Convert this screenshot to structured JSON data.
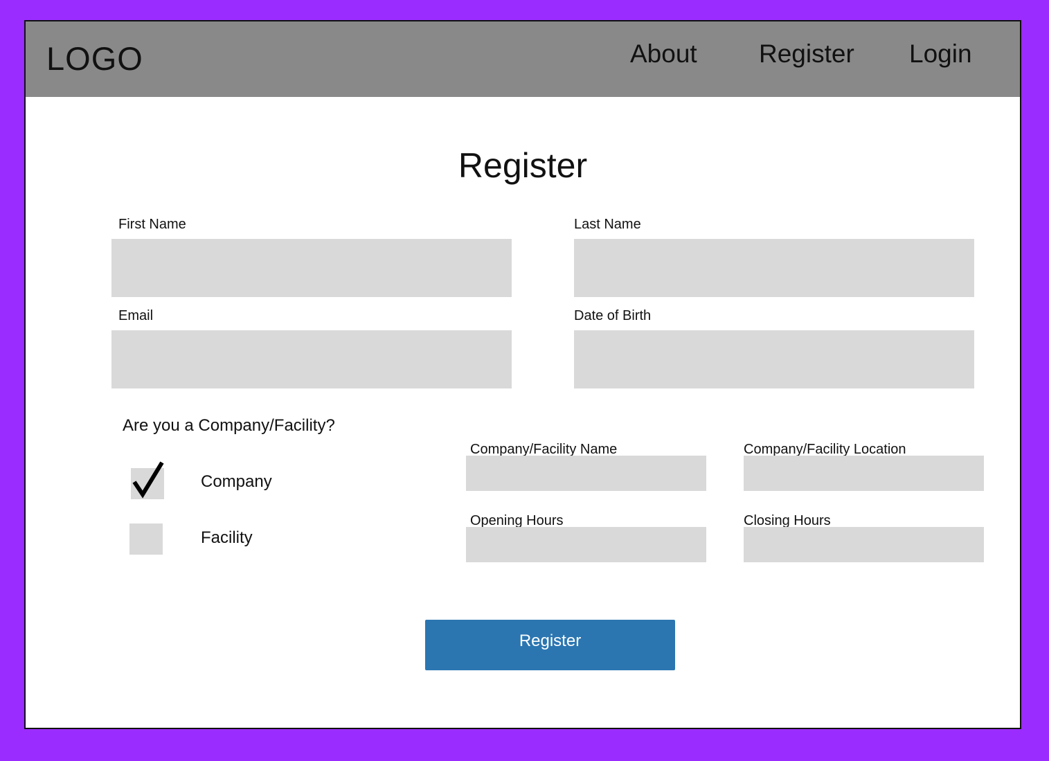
{
  "header": {
    "logo": "LOGO",
    "nav": {
      "about": "About",
      "register": "Register",
      "login": "Login"
    }
  },
  "form": {
    "title": "Register",
    "first_name": {
      "label": "First Name",
      "value": ""
    },
    "last_name": {
      "label": "Last Name",
      "value": ""
    },
    "email": {
      "label": "Email",
      "value": ""
    },
    "date_of_birth": {
      "label": "Date of Birth",
      "value": ""
    },
    "entity_question": "Are you a Company/Facility?",
    "options": {
      "company": {
        "label": "Company",
        "checked": true
      },
      "facility": {
        "label": "Facility",
        "checked": false
      }
    },
    "facility_name": {
      "label": "Company/Facility Name",
      "value": ""
    },
    "facility_location": {
      "label": "Company/Facility Location",
      "value": ""
    },
    "opening_hours": {
      "label": "Opening Hours",
      "value": ""
    },
    "closing_hours": {
      "label": "Closing Hours",
      "value": ""
    },
    "submit_label": "Register"
  },
  "colors": {
    "background": "#9b2cff",
    "header": "#898989",
    "input": "#d9d9d9",
    "button": "#2b76b1"
  }
}
